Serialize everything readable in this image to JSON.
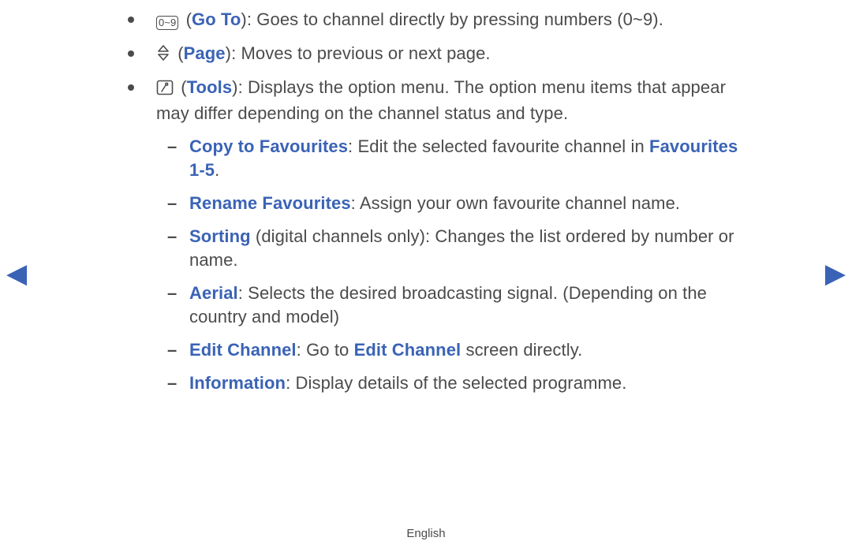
{
  "nav": {
    "left": "◀",
    "right": "▶"
  },
  "items": [
    {
      "icon_type": "digits",
      "icon_label": "0~9",
      "label_open": " (",
      "name": "Go To",
      "label_close": ")",
      "desc": ": Goes to channel directly by pressing numbers (0~9)."
    },
    {
      "icon_type": "updown",
      "label_open": " (",
      "name": "Page",
      "label_close": ")",
      "desc": ": Moves to previous or next page."
    },
    {
      "icon_type": "tools",
      "label_open": " (",
      "name": "Tools",
      "label_close": ")",
      "desc": ": Displays the option menu. The option menu items that appear may differ depending on the channel status and type.",
      "sub": [
        {
          "name": "Copy to Favourites",
          "desc_pre": ": Edit the selected favourite channel in ",
          "inline": "Favourites 1-5",
          "desc_post": "."
        },
        {
          "name": "Rename Favourites",
          "desc_pre": ": Assign your own favourite channel name.",
          "inline": "",
          "desc_post": ""
        },
        {
          "name": "Sorting",
          "note": " (digital channels only)",
          "desc_pre": ": Changes the list ordered by number or name.",
          "inline": "",
          "desc_post": ""
        },
        {
          "name": "Aerial",
          "desc_pre": ": Selects the desired broadcasting signal. (Depending on the country and model)",
          "inline": "",
          "desc_post": ""
        },
        {
          "name": "Edit Channel",
          "desc_pre": ": Go to ",
          "inline": "Edit Channel",
          "desc_post": " screen directly."
        },
        {
          "name": "Information",
          "desc_pre": ": Display details of the selected programme.",
          "inline": "",
          "desc_post": ""
        }
      ]
    }
  ],
  "footer": {
    "language": "English"
  }
}
